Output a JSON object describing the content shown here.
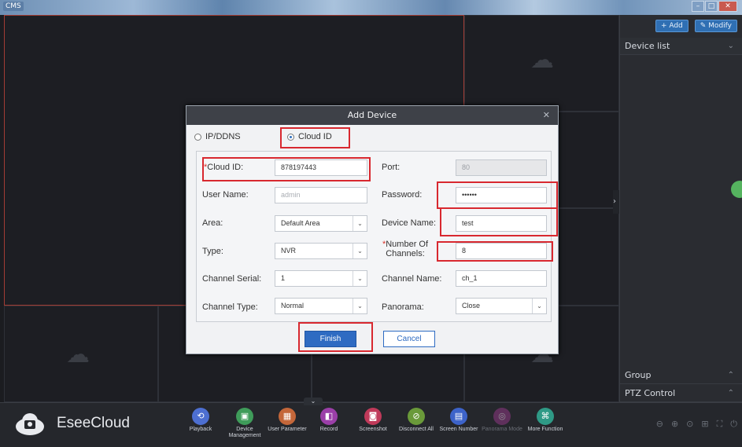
{
  "window": {
    "title": "CMS"
  },
  "right_panel": {
    "add_button": "+ Add",
    "modify_button": "Modify",
    "device_list": "Device list",
    "group": "Group",
    "ptz_control": "PTZ Control"
  },
  "taskbar": {
    "brand": "EseeCloud",
    "buttons": [
      {
        "label": "Playback",
        "color": "#4d6fd1"
      },
      {
        "label": "Device Management",
        "color": "#3f9c5a"
      },
      {
        "label": "User Parameter",
        "color": "#c4673a"
      },
      {
        "label": "Record",
        "color": "#9b3fa8"
      },
      {
        "label": "Screenshot",
        "color": "#c03a5a"
      },
      {
        "label": "Disconnect All",
        "color": "#6a9a3a"
      },
      {
        "label": "Screen Number",
        "color": "#3d63c9"
      },
      {
        "label": "Panorama Mode",
        "color": "#9a3a8c"
      },
      {
        "label": "More Function",
        "color": "#2f9a86"
      }
    ]
  },
  "dialog": {
    "title": "Add Device",
    "mode_ip": "IP/DDNS",
    "mode_cloud": "Cloud ID",
    "selected_mode": "Cloud ID",
    "fields": {
      "cloud_id_label": "Cloud ID:",
      "cloud_id_value": "878197443",
      "port_label": "Port:",
      "port_value": "80",
      "user_name_label": "User Name:",
      "user_name_placeholder": "admin",
      "password_label": "Password:",
      "password_value": "••••••",
      "area_label": "Area:",
      "area_value": "Default Area",
      "device_name_label": "Device Name:",
      "device_name_value": "test",
      "type_label": "Type:",
      "type_value": "NVR",
      "channels_label_line1": "Number Of",
      "channels_label_line2": "Channels:",
      "channels_value": "8",
      "channel_serial_label": "Channel Serial:",
      "channel_serial_value": "1",
      "channel_name_label": "Channel Name:",
      "channel_name_value": "ch_1",
      "channel_type_label": "Channel Type:",
      "channel_type_value": "Normal",
      "panorama_label": "Panorama:",
      "panorama_value": "Close"
    },
    "finish_label": "Finish",
    "cancel_label": "Cancel"
  }
}
